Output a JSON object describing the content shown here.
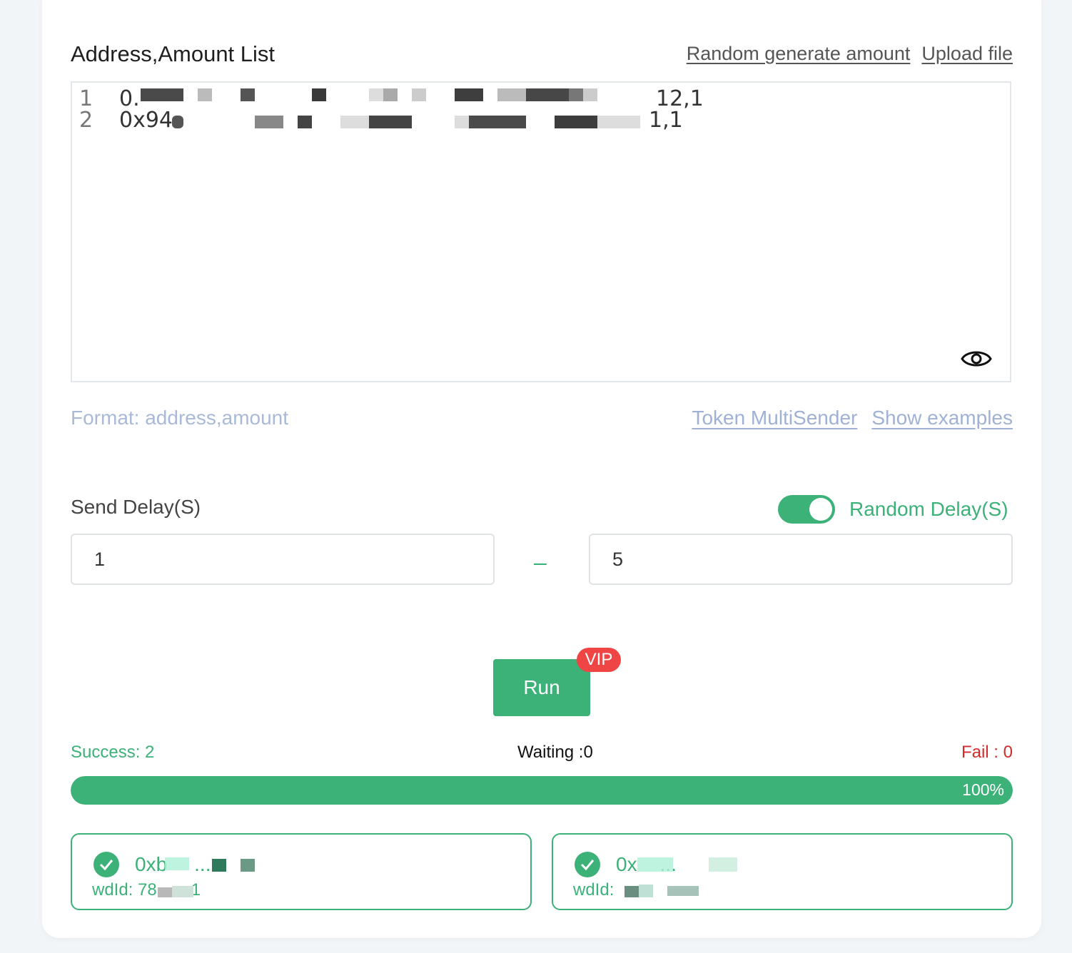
{
  "address_list": {
    "title": "Address,Amount List",
    "random_generate_label": "Random generate amount",
    "upload_label": "Upload file",
    "lines": [
      {
        "number": "1",
        "prefix": "0.",
        "suffix": "12,1"
      },
      {
        "number": "2",
        "prefix": "0x94",
        "suffix": "1,1"
      }
    ],
    "format_hint": "Format: address,amount",
    "token_multisender_label": "Token MultiSender",
    "show_examples_label": "Show examples"
  },
  "delay": {
    "label": "Send Delay(S)",
    "random_enabled": true,
    "random_label": "Random Delay(S)",
    "min_value": "1",
    "separator": "–",
    "max_value": "5"
  },
  "run": {
    "label": "Run",
    "vip_badge": "VIP"
  },
  "stats": {
    "success": "Success: 2",
    "waiting": "Waiting :0",
    "fail": "Fail : 0",
    "progress_percent": 100,
    "progress_text": "100%"
  },
  "results": [
    {
      "tx": "0xb",
      "tx_suffix": "...",
      "wdid": "wdId: 78",
      "wdid_suffix": "1"
    },
    {
      "tx": "0x",
      "tx_suffix": "...",
      "wdid": "wdId: ",
      "wdid_suffix": ""
    }
  ],
  "colors": {
    "accent": "#3cb178",
    "fail": "#d22b2b",
    "vip": "#f04545",
    "link_light": "#9fb2d6"
  },
  "icons": [
    "eye-icon",
    "check-icon"
  ]
}
